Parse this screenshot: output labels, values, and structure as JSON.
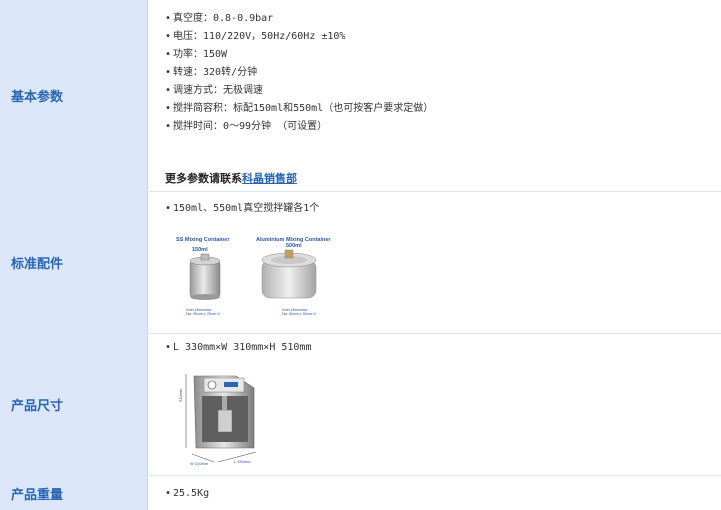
{
  "rows": [
    {
      "label": "基本参数",
      "items": [
        "真空度：0.8-0.9bar",
        "电压：110/220V，50Hz/60Hz ±10%",
        "功率：150W",
        "转速：320转/分钟",
        "调速方式：无极调速",
        "搅拌简容积：标配150ml和550ml（也可按客户要求定做）",
        "搅拌时间：0～99分钟  （可设置）"
      ],
      "contact_prefix": "更多参数请联系",
      "contact_link": "科晶销售部"
    },
    {
      "label": "标准配件",
      "items": [
        "150ml、550ml真空搅拌罐各1个"
      ],
      "image": {
        "left_title": "SS Mixing Container",
        "left_sub": "150ml",
        "right_title": "Aluminium Mixing Container",
        "right_sub": "500ml",
        "left_dim_1": "Inner Dimension",
        "left_dim_2": "Dia. 56mm x 75mm H",
        "right_dim_1": "Inner Dimension",
        "right_dim_2": "Dia. 86mm x 92mm H"
      }
    },
    {
      "label": "产品尺寸",
      "items": [
        "L 330mm×W 310mm×H 510mm"
      ],
      "image": {
        "dim_h": "510mm",
        "dim_w": "W 310mm",
        "dim_l": "L 330mm"
      }
    },
    {
      "label": "产品重量",
      "items": [
        "25.5Kg"
      ]
    }
  ],
  "colors": {
    "label_bg": "#dbe7f8",
    "label_text": "#2b66b2",
    "link": "#2b66b2"
  }
}
